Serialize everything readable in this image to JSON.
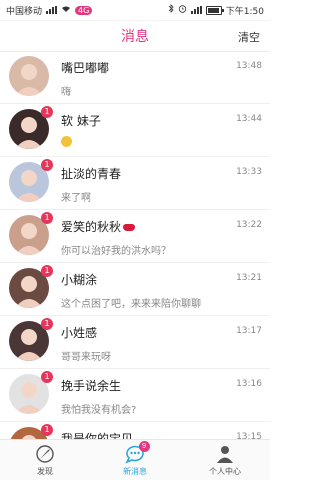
{
  "status_bar": {
    "carrier": "中国移动",
    "extra_badge": "4G",
    "time": "下午1:50",
    "battery_level": 0.9
  },
  "header": {
    "title": "消息",
    "clear_label": "清空"
  },
  "messages": [
    {
      "name": "嘴巴嘟嘟",
      "preview": "嗨",
      "time": "13:48",
      "unread": "",
      "avatar_color": "#d9b9a8"
    },
    {
      "name": "软 妹子",
      "preview": "",
      "emoji": "smile",
      "time": "13:44",
      "unread": "1",
      "avatar_color": "#3a2a2a"
    },
    {
      "name": "扯淡的青春",
      "preview": "来了啊",
      "time": "13:33",
      "unread": "1",
      "avatar_color": "#b9c6dc"
    },
    {
      "name": "爱笑的秋秋",
      "name_suffix_icon": "lips-icon",
      "preview": "你可以治好我的洪水吗？",
      "time": "13:22",
      "unread": "1",
      "avatar_color": "#caa08c"
    },
    {
      "name": "小糊涂",
      "preview": "这个点困了吧，来来来陪你聊聊",
      "time": "13:21",
      "unread": "1",
      "avatar_color": "#6b4a42"
    },
    {
      "name": "小姓感",
      "preview": "哥哥来玩呀",
      "time": "13:17",
      "unread": "1",
      "avatar_color": "#4a3636"
    },
    {
      "name": "挽手说余生",
      "preview": "我怕我没有机会?",
      "time": "13:16",
      "unread": "1",
      "avatar_color": "#e2e2e2"
    },
    {
      "name": "我是你的宝贝",
      "preview": "",
      "time": "13:15",
      "unread": "1",
      "avatar_color": "#b4673f"
    }
  ],
  "tabbar": {
    "tabs": [
      {
        "label": "发现",
        "icon": "discover-icon"
      },
      {
        "label": "新消息",
        "icon": "message-icon",
        "badge": "9"
      },
      {
        "label": "个人中心",
        "icon": "profile-icon"
      }
    ]
  },
  "colors": {
    "accent": "#e5377f",
    "active_tab": "#2aa7d8",
    "unread_badge": "#e5375c"
  }
}
